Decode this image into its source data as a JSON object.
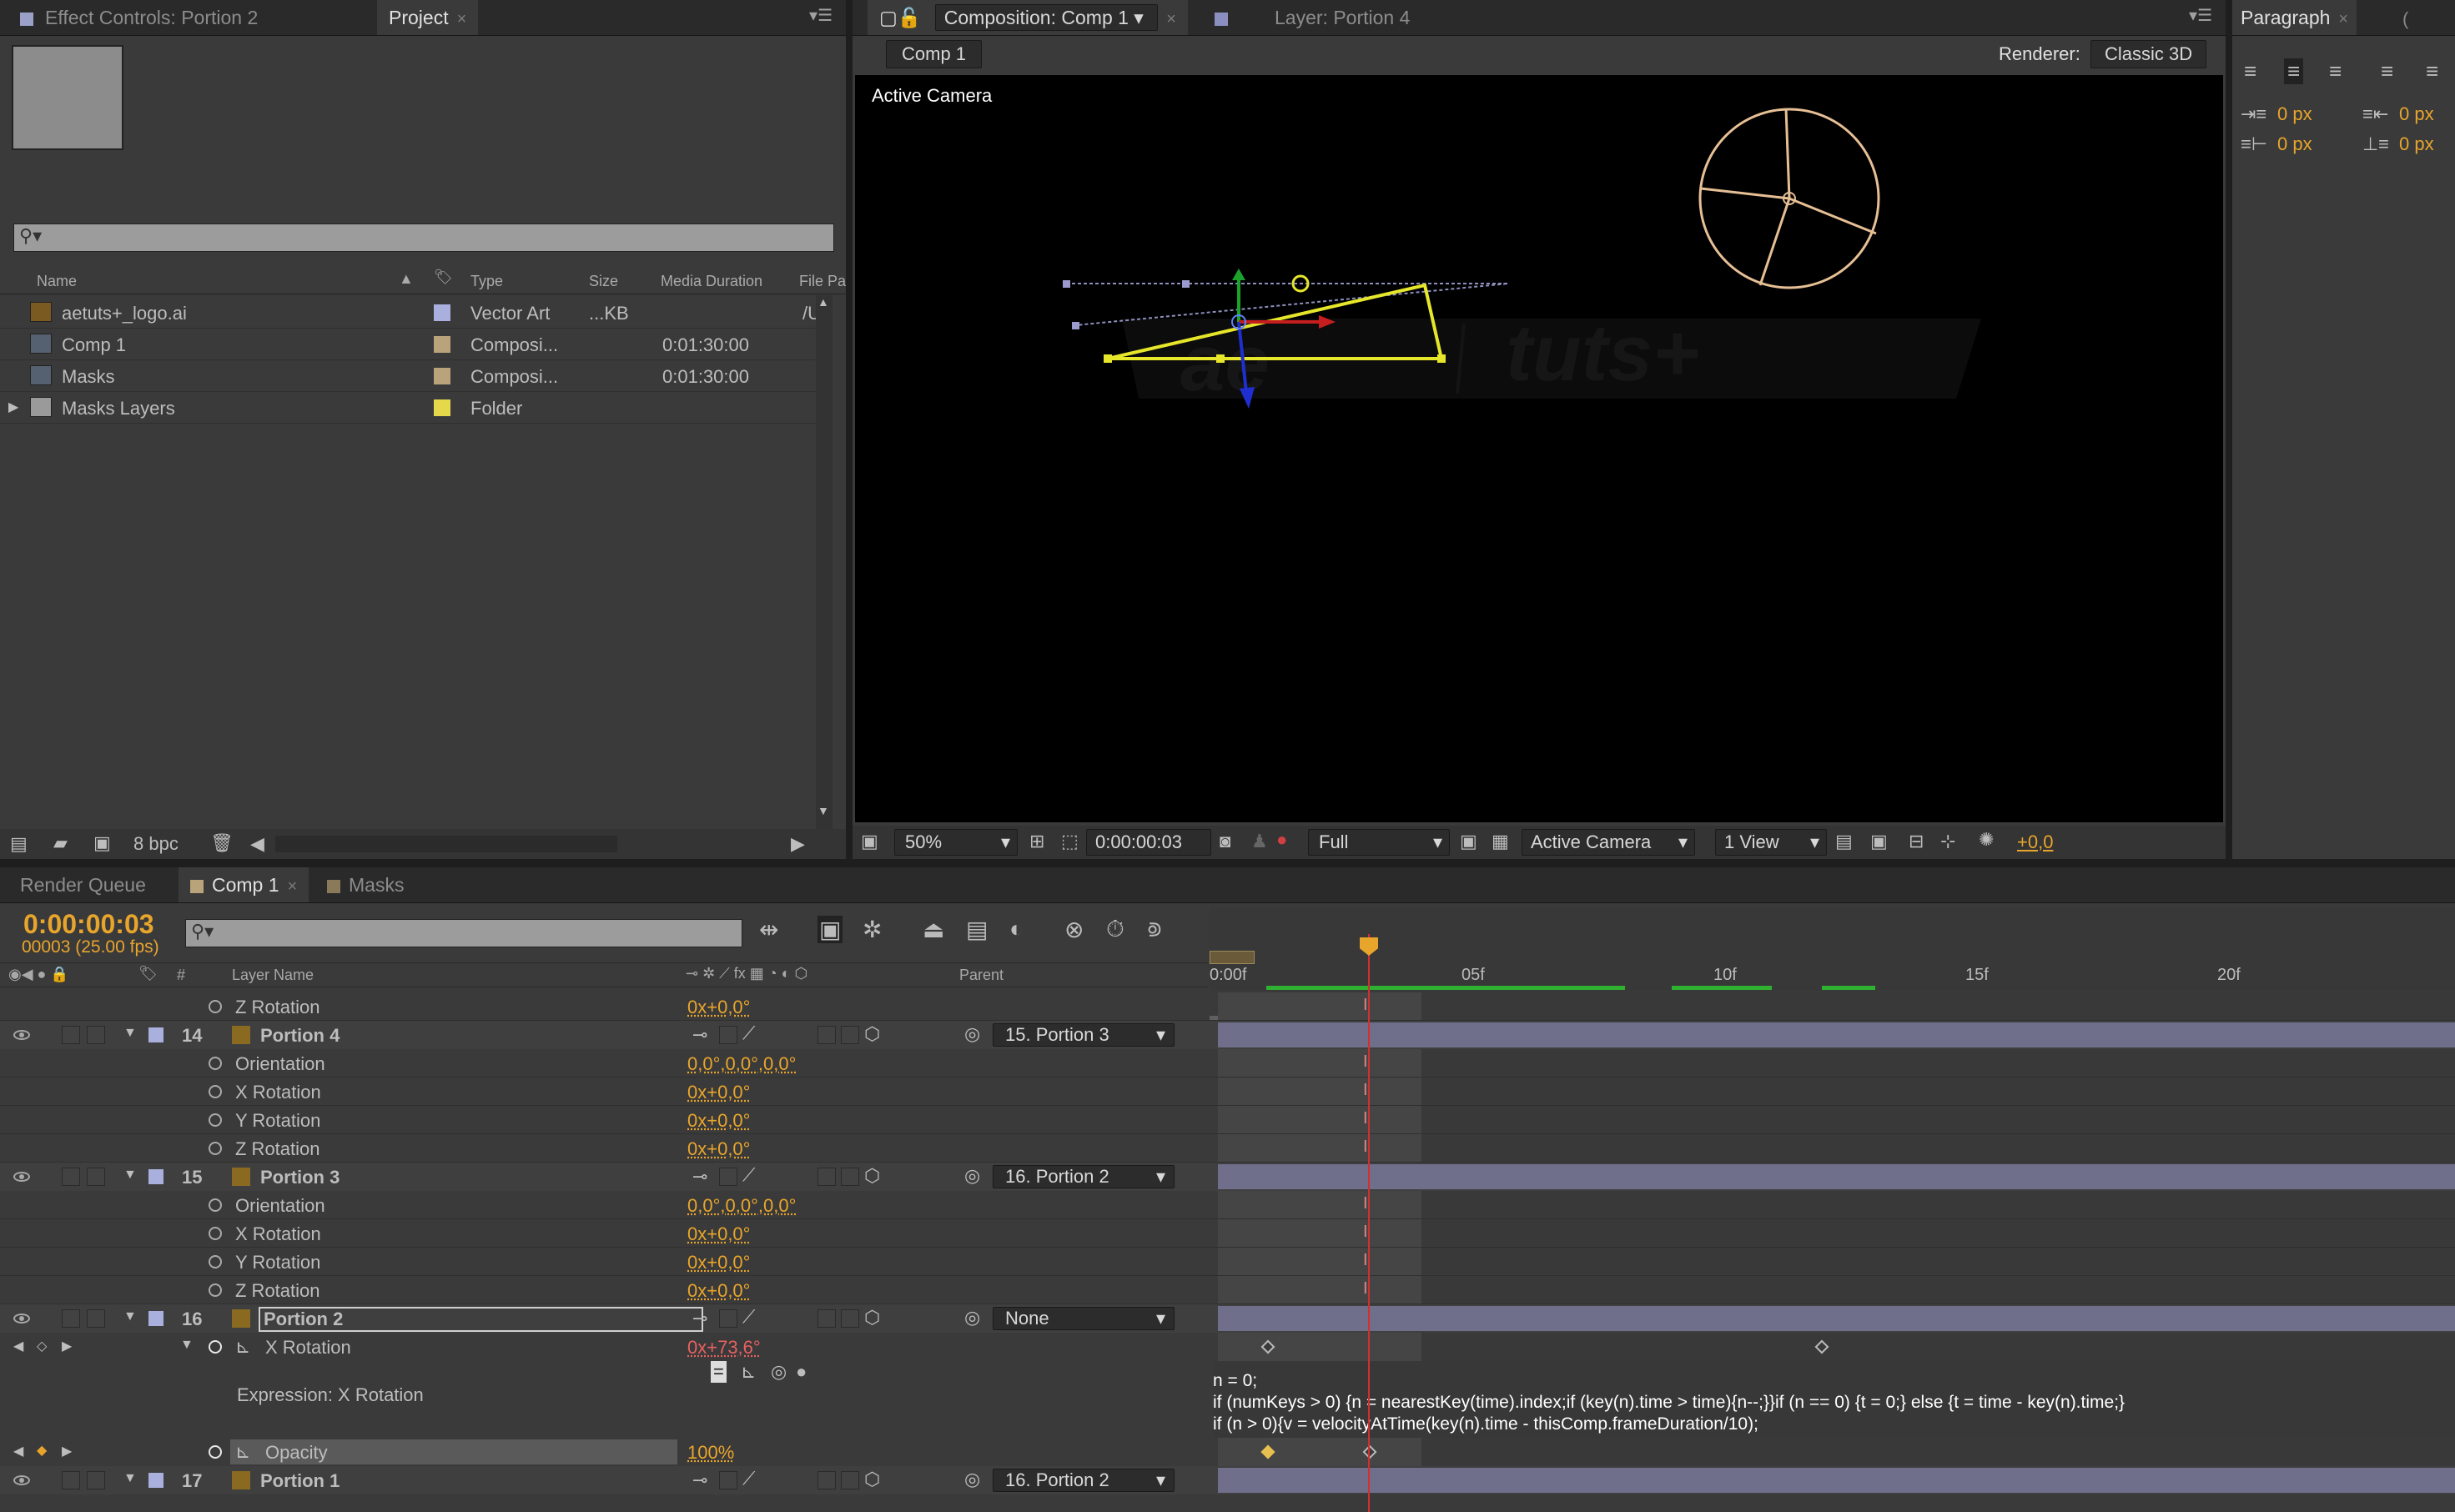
{
  "top_left": {
    "tabs": [
      "Effect Controls: Portion 2",
      "Project"
    ],
    "search_placeholder": "",
    "columns": [
      "Name",
      "Type",
      "Size",
      "Media Duration",
      "File Pa"
    ],
    "items": [
      {
        "name": "aetuts+_logo.ai",
        "type": "Vector Art",
        "size": "...KB",
        "duration": "",
        "path": "/U",
        "color": "#aab0dd",
        "icon": "illustrator-file-icon"
      },
      {
        "name": "Comp 1",
        "type": "Composi...",
        "size": "",
        "duration": "0:01:30:00",
        "path": "",
        "color": "#b9a37a",
        "icon": "composition-icon"
      },
      {
        "name": "Masks",
        "type": "Composi...",
        "size": "",
        "duration": "0:01:30:00",
        "path": "",
        "color": "#b9a37a",
        "icon": "composition-icon"
      },
      {
        "name": "Masks Layers",
        "type": "Folder",
        "size": "",
        "duration": "",
        "path": "",
        "color": "#e5d94b",
        "icon": "folder-icon"
      }
    ],
    "bpc": "8 bpc"
  },
  "comp_viewer": {
    "tab_comp": "Composition: Comp 1",
    "tab_layer": "Layer: Portion 4",
    "breadcrumb": "Comp 1",
    "renderer_label": "Renderer:",
    "renderer_value": "Classic 3D",
    "view_label": "Active Camera",
    "logo_left": "ae",
    "logo_right": "tuts+",
    "zoom": "50%",
    "timecode": "0:00:00:03",
    "resolution": "Full",
    "camera": "Active Camera",
    "views": "1 View",
    "exposure": "+0,0"
  },
  "paragraph": {
    "tab": "Paragraph",
    "values": [
      "0 px",
      "0 px",
      "0 px",
      "0 px"
    ]
  },
  "timeline": {
    "tabs": [
      "Render Queue",
      "Comp 1",
      "Masks"
    ],
    "timecode": "0:00:00:03",
    "frames": "00003 (25.00 fps)",
    "col_layer_name": "Layer Name",
    "col_parent": "Parent",
    "col_num": "#",
    "ruler": [
      "0:00f",
      "05f",
      "10f",
      "15f",
      "20f"
    ],
    "rows": [
      {
        "kind": "prop",
        "label": "Z Rotation",
        "value": "0x+0,0°"
      },
      {
        "kind": "layer",
        "num": "14",
        "label": "Portion 4",
        "parent": "15. Portion 3"
      },
      {
        "kind": "prop",
        "label": "Orientation",
        "value": "0,0°,0,0°,0,0°"
      },
      {
        "kind": "prop",
        "label": "X Rotation",
        "value": "0x+0,0°"
      },
      {
        "kind": "prop",
        "label": "Y Rotation",
        "value": "0x+0,0°"
      },
      {
        "kind": "prop",
        "label": "Z Rotation",
        "value": "0x+0,0°"
      },
      {
        "kind": "layer",
        "num": "15",
        "label": "Portion 3",
        "parent": "16. Portion 2"
      },
      {
        "kind": "prop",
        "label": "Orientation",
        "value": "0,0°,0,0°,0,0°"
      },
      {
        "kind": "prop",
        "label": "X Rotation",
        "value": "0x+0,0°"
      },
      {
        "kind": "prop",
        "label": "Y Rotation",
        "value": "0x+0,0°"
      },
      {
        "kind": "prop",
        "label": "Z Rotation",
        "value": "0x+0,0°"
      },
      {
        "kind": "layer",
        "num": "16",
        "label": "Portion 2",
        "parent": "None"
      }
    ],
    "xrot_label": "X Rotation",
    "xrot_value": "0x+73,6°",
    "expression_label": "Expression: X Rotation",
    "expression_lines": [
      "n = 0;",
      "if (numKeys > 0) {n = nearestKey(time).index;if (key(n).time > time){n--;}}if (n == 0) {t = 0;} else {t = time - key(n).time;}",
      "if (n > 0){v = velocityAtTime(key(n).time - thisComp.frameDuration/10);"
    ],
    "opacity_label": "Opacity",
    "opacity_value": "100%",
    "last_layer": {
      "num": "17",
      "label": "Portion 1",
      "parent": "16. Portion 2"
    }
  }
}
